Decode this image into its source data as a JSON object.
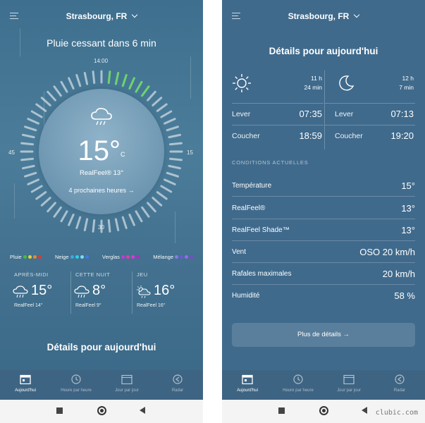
{
  "left": {
    "city": "Strasbourg, FR",
    "precip_message": "Pluie cessant dans 6 min",
    "dial": {
      "top": "14:00",
      "right": "15",
      "bottom": "30",
      "left": "45"
    },
    "current": {
      "temp": "15°",
      "unit": "C",
      "realfeel": "RealFeel® 13°",
      "next_hours": "4 prochaines heures →"
    },
    "legend": [
      {
        "label": "Pluie",
        "colors": [
          "#3fbf3f",
          "#e8d23a",
          "#e88a2a",
          "#d83a3a"
        ]
      },
      {
        "label": "Neige",
        "colors": [
          "#3aa9e8",
          "#2ad0e8",
          "#7adcf4",
          "#3a7ae8"
        ]
      },
      {
        "label": "Verglas",
        "colors": [
          "#c23ad8",
          "#e83aa9",
          "#d83ad8",
          "#b02ac0"
        ]
      },
      {
        "label": "Mélange",
        "colors": [
          "#8a7ae8",
          "#6a5ad8",
          "#9a6ae8",
          "#7a4ac8"
        ]
      }
    ],
    "forecast": [
      {
        "label": "APRÈS-MIDI",
        "temp": "15°",
        "realfeel": "RealFeel 14°",
        "icon": "rain-cloud-icon"
      },
      {
        "label": "CETTE NUIT",
        "temp": "8°",
        "realfeel": "RealFeel 9°",
        "icon": "rain-cloud-icon"
      },
      {
        "label": "JEU",
        "temp": "16°",
        "realfeel": "RealFeel 16°",
        "icon": "sun-rain-cloud-icon"
      }
    ],
    "details_title": "Détails pour aujourd'hui"
  },
  "right": {
    "city": "Strasbourg, FR",
    "title": "Détails pour aujourd'hui",
    "sun": {
      "hours": "11 h",
      "minutes": "24 min",
      "rise_label": "Lever",
      "rise": "07:35",
      "set_label": "Coucher",
      "set": "18:59"
    },
    "moon": {
      "hours": "12 h",
      "minutes": "7 min",
      "rise_label": "Lever",
      "rise": "07:13",
      "set_label": "Coucher",
      "set": "19:20"
    },
    "section": "CONDITIONS ACTUELLES",
    "conditions": [
      {
        "label": "Température",
        "value": "15°"
      },
      {
        "label": "RealFeel®",
        "value": "13°"
      },
      {
        "label": "RealFeel Shade™",
        "value": "13°"
      },
      {
        "label": "Vent",
        "value": "OSO 20 km/h"
      },
      {
        "label": "Rafales maximales",
        "value": "20 km/h"
      },
      {
        "label": "Humidité",
        "value": "58 %"
      }
    ],
    "more_button": "Plus de détails →"
  },
  "tabs": [
    {
      "label": "Aujourd'hui",
      "icon": "calendar-today-icon"
    },
    {
      "label": "Heure par heure",
      "icon": "clock-icon"
    },
    {
      "label": "Jour par jour",
      "icon": "calendar-icon"
    },
    {
      "label": "Radar",
      "icon": "radar-icon"
    }
  ],
  "watermark": "clubic.com"
}
